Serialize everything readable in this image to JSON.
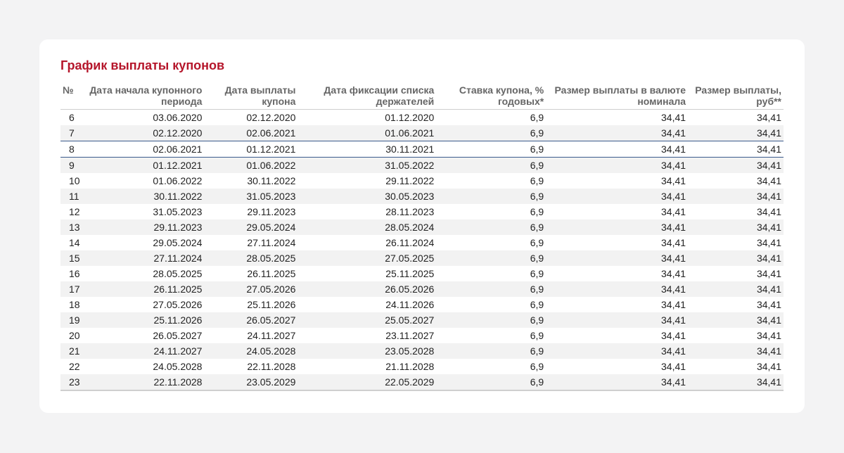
{
  "title": "График выплаты купонов",
  "columns": [
    "№",
    "Дата начала купонного периода",
    "Дата выплаты купона",
    "Дата фиксации списка держателей",
    "Ставка купона, % годовых*",
    "Размер выплаты в валюте номинала",
    "Размер выплаты, руб**"
  ],
  "rows": [
    {
      "n": "6",
      "start": "03.06.2020",
      "pay": "02.12.2020",
      "fix": "01.12.2020",
      "rate": "6,9",
      "amount": "34,41",
      "rub": "34,41"
    },
    {
      "n": "7",
      "start": "02.12.2020",
      "pay": "02.06.2021",
      "fix": "01.06.2021",
      "rate": "6,9",
      "amount": "34,41",
      "rub": "34,41"
    },
    {
      "n": "8",
      "start": "02.06.2021",
      "pay": "01.12.2021",
      "fix": "30.11.2021",
      "rate": "6,9",
      "amount": "34,41",
      "rub": "34,41"
    },
    {
      "n": "9",
      "start": "01.12.2021",
      "pay": "01.06.2022",
      "fix": "31.05.2022",
      "rate": "6,9",
      "amount": "34,41",
      "rub": "34,41"
    },
    {
      "n": "10",
      "start": "01.06.2022",
      "pay": "30.11.2022",
      "fix": "29.11.2022",
      "rate": "6,9",
      "amount": "34,41",
      "rub": "34,41"
    },
    {
      "n": "11",
      "start": "30.11.2022",
      "pay": "31.05.2023",
      "fix": "30.05.2023",
      "rate": "6,9",
      "amount": "34,41",
      "rub": "34,41"
    },
    {
      "n": "12",
      "start": "31.05.2023",
      "pay": "29.11.2023",
      "fix": "28.11.2023",
      "rate": "6,9",
      "amount": "34,41",
      "rub": "34,41"
    },
    {
      "n": "13",
      "start": "29.11.2023",
      "pay": "29.05.2024",
      "fix": "28.05.2024",
      "rate": "6,9",
      "amount": "34,41",
      "rub": "34,41"
    },
    {
      "n": "14",
      "start": "29.05.2024",
      "pay": "27.11.2024",
      "fix": "26.11.2024",
      "rate": "6,9",
      "amount": "34,41",
      "rub": "34,41"
    },
    {
      "n": "15",
      "start": "27.11.2024",
      "pay": "28.05.2025",
      "fix": "27.05.2025",
      "rate": "6,9",
      "amount": "34,41",
      "rub": "34,41"
    },
    {
      "n": "16",
      "start": "28.05.2025",
      "pay": "26.11.2025",
      "fix": "25.11.2025",
      "rate": "6,9",
      "amount": "34,41",
      "rub": "34,41"
    },
    {
      "n": "17",
      "start": "26.11.2025",
      "pay": "27.05.2026",
      "fix": "26.05.2026",
      "rate": "6,9",
      "amount": "34,41",
      "rub": "34,41"
    },
    {
      "n": "18",
      "start": "27.05.2026",
      "pay": "25.11.2026",
      "fix": "24.11.2026",
      "rate": "6,9",
      "amount": "34,41",
      "rub": "34,41"
    },
    {
      "n": "19",
      "start": "25.11.2026",
      "pay": "26.05.2027",
      "fix": "25.05.2027",
      "rate": "6,9",
      "amount": "34,41",
      "rub": "34,41"
    },
    {
      "n": "20",
      "start": "26.05.2027",
      "pay": "24.11.2027",
      "fix": "23.11.2027",
      "rate": "6,9",
      "amount": "34,41",
      "rub": "34,41"
    },
    {
      "n": "21",
      "start": "24.11.2027",
      "pay": "24.05.2028",
      "fix": "23.05.2028",
      "rate": "6,9",
      "amount": "34,41",
      "rub": "34,41"
    },
    {
      "n": "22",
      "start": "24.05.2028",
      "pay": "22.11.2028",
      "fix": "21.11.2028",
      "rate": "6,9",
      "amount": "34,41",
      "rub": "34,41"
    },
    {
      "n": "23",
      "start": "22.11.2028",
      "pay": "23.05.2029",
      "fix": "22.05.2029",
      "rate": "6,9",
      "amount": "34,41",
      "rub": "34,41"
    }
  ],
  "highlighted_row": "8",
  "colors": {
    "title": "#b5162b",
    "highlight_border": "#3a5a8c",
    "stripe": "#f2f2f2",
    "background": "#f3f3f4"
  }
}
